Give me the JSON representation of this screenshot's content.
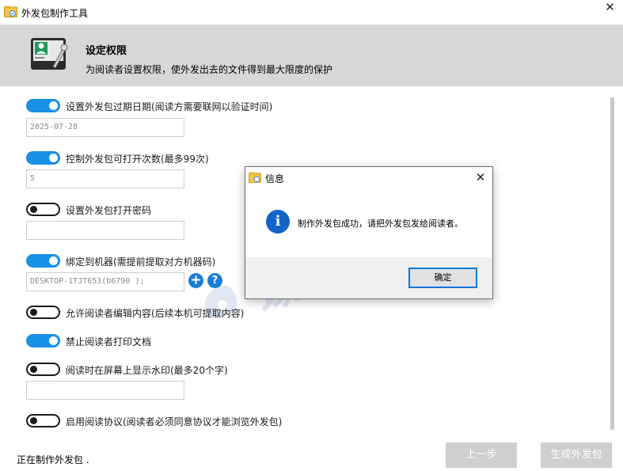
{
  "window": {
    "title": "外发包制作工具",
    "close_glyph": "✕",
    "app_icon": "folder-app-icon"
  },
  "header": {
    "title": "设定权限",
    "subtitle": "为阅读者设置权限，使外发出去的文件得到最大限度的保护",
    "icon": "id-card-permission-icon"
  },
  "options": [
    {
      "label": "设置外发包过期日期(阅读方需要联网以验证时间)",
      "enabled": true,
      "field_value": "2025-07-28"
    },
    {
      "label": "控制外发包可打开次数(最多99次)",
      "enabled": true,
      "field_value": "5"
    },
    {
      "label": "设置外发包打开密码",
      "enabled": false,
      "field_value": ""
    },
    {
      "label": "绑定到机器(需提前提取对方机器码)",
      "enabled": true,
      "field_value": "DESKTOP-1TJT653(D6790⁠  );"
    },
    {
      "label": "允许阅读者编辑内容(后续本机可提取内容)",
      "enabled": false
    },
    {
      "label": "禁止阅读者打印文档",
      "enabled": true
    },
    {
      "label": "阅读时在屏幕上显示水印(最多20个字)",
      "enabled": false,
      "field_value": ""
    },
    {
      "label": "启用阅读协议(阅读者必须同意协议才能浏览外发包)",
      "enabled": false
    }
  ],
  "machine_buttons": {
    "add": "+",
    "help": "?"
  },
  "footer": {
    "status": "正在制作外发包 .",
    "prev_label": "上一步",
    "generate_label": "生成外发包"
  },
  "dialog": {
    "title": "信息",
    "message": "制作外发包成功，请把外发包发给阅读者。",
    "ok_label": "确定",
    "close_glyph": "✕",
    "info_glyph": "i"
  },
  "watermark": {
    "text": "域智盾软件"
  },
  "colors": {
    "toggle_on": "#1890e6",
    "header_bg": "#d7d7d7",
    "info_blue": "#1264c8",
    "disabled_btn": "#cfcfcf"
  }
}
